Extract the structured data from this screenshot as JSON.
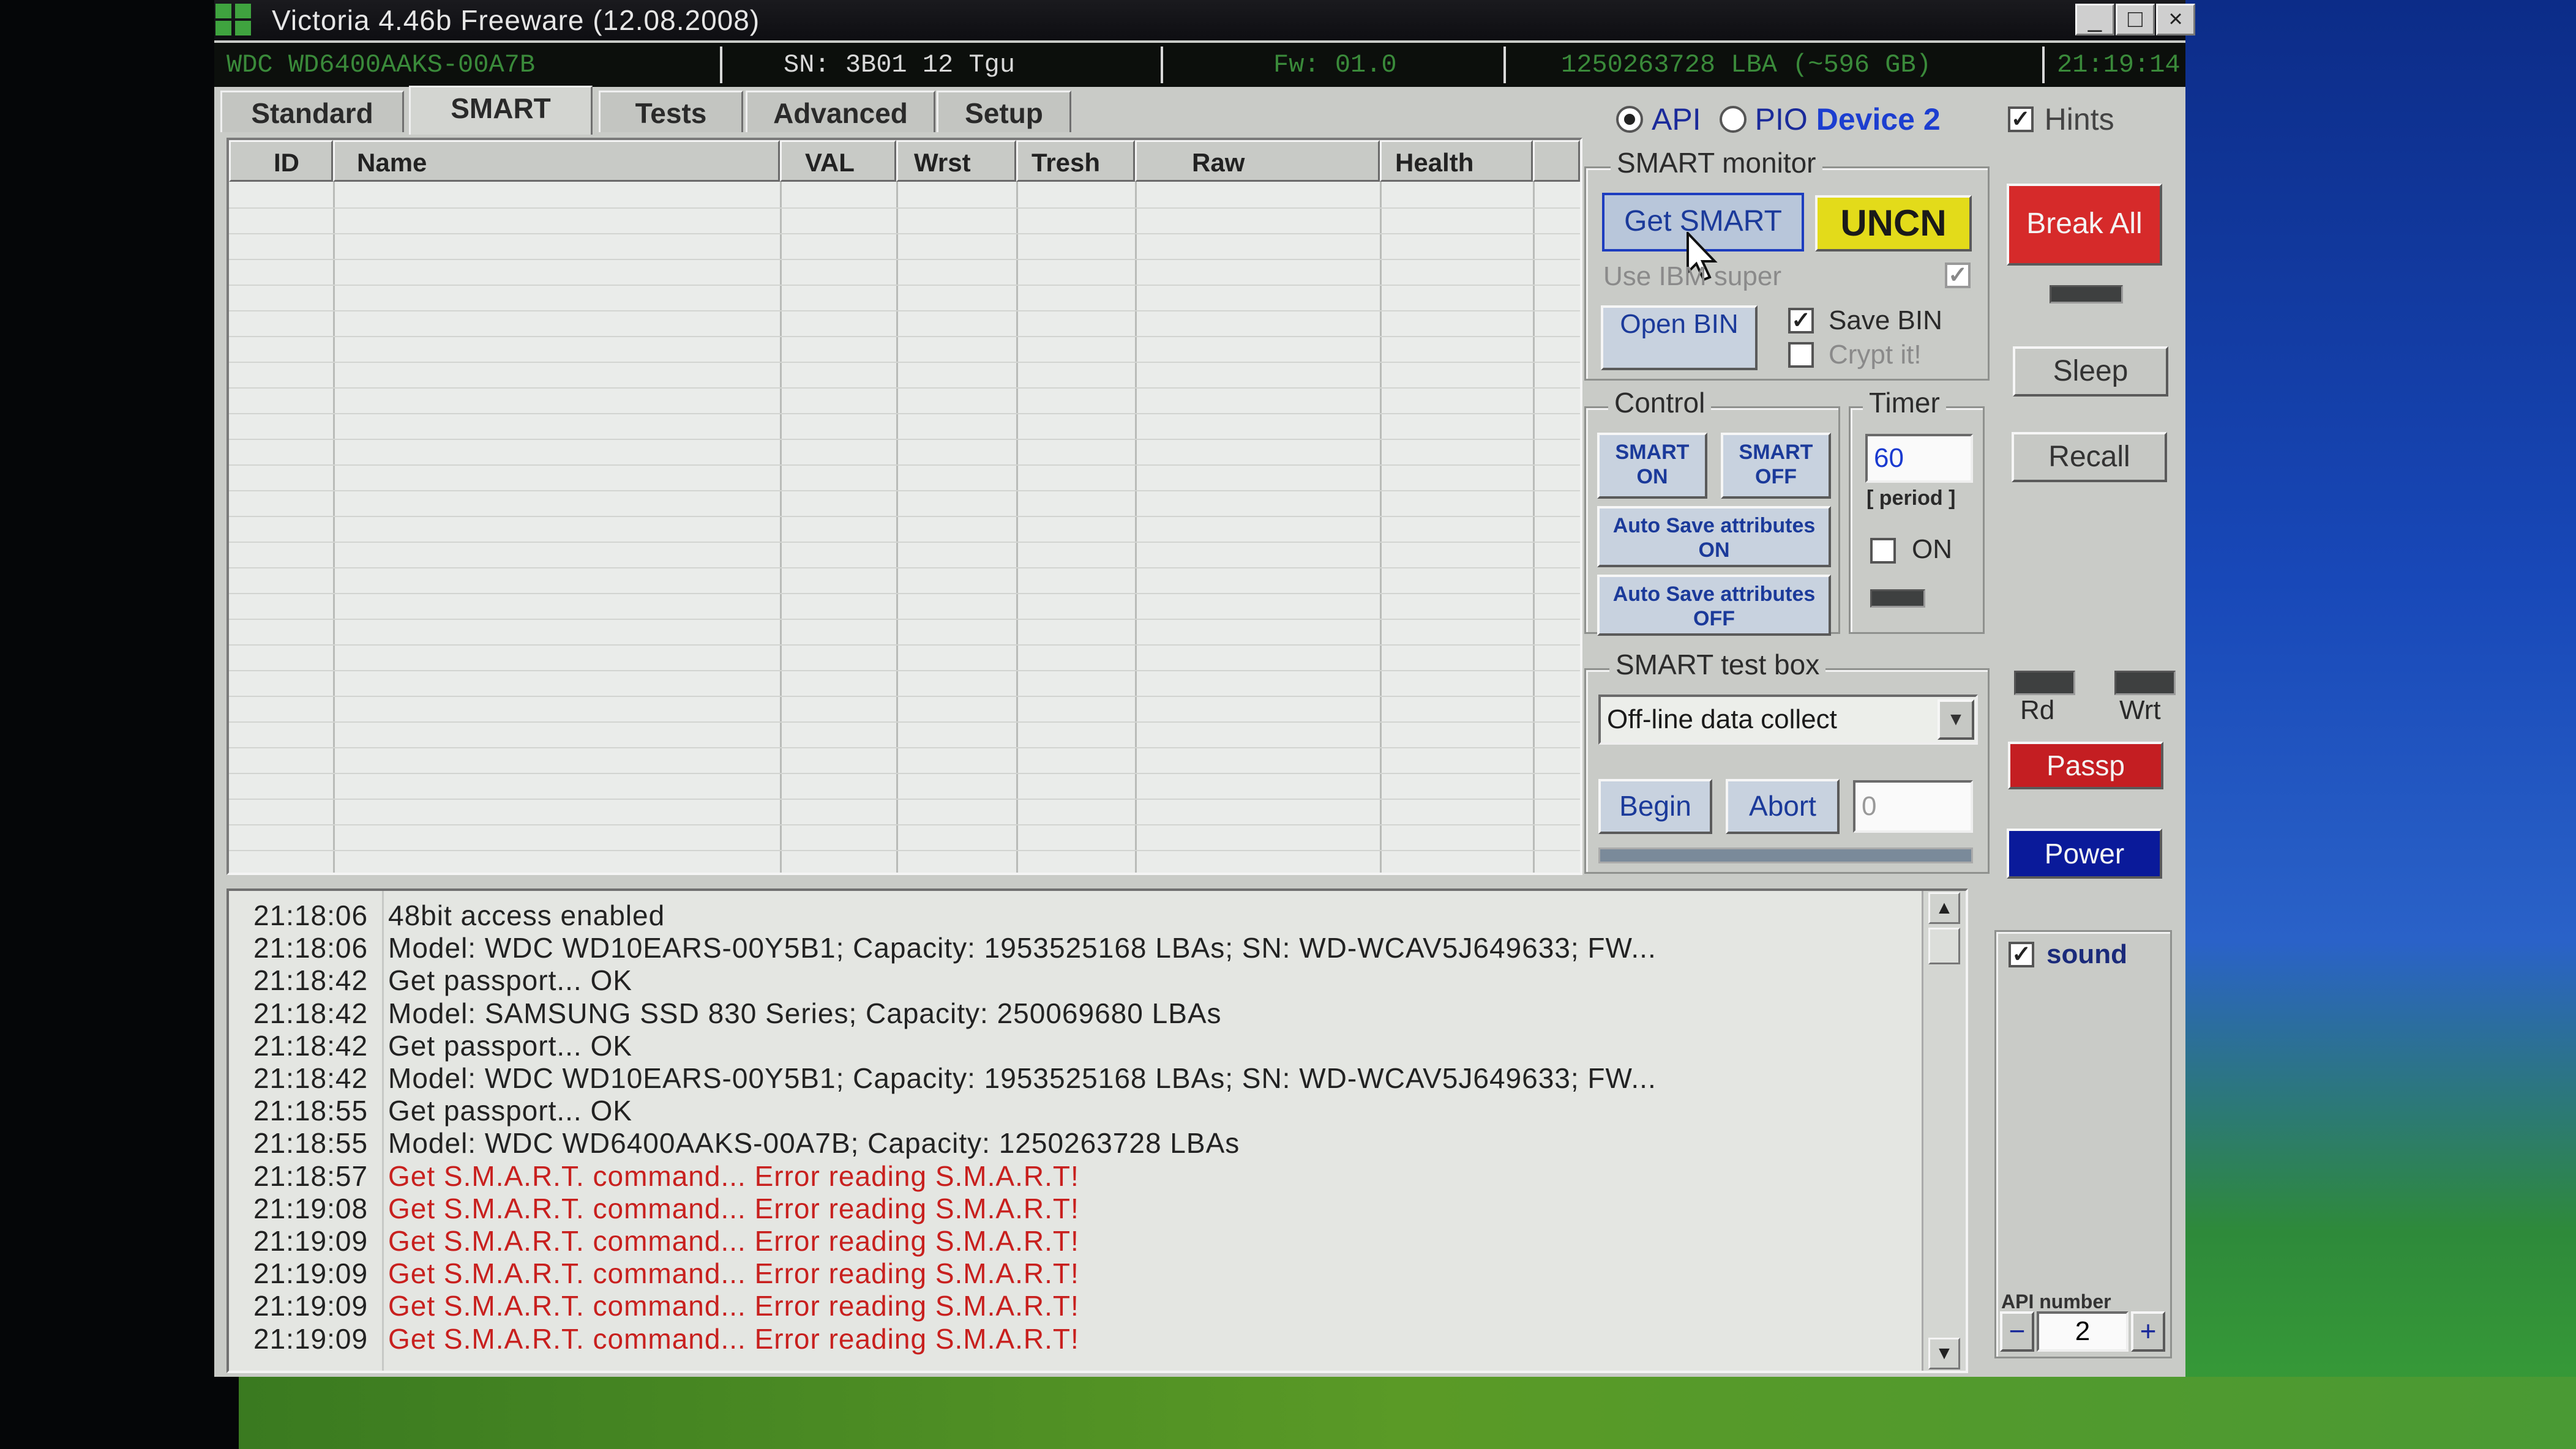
{
  "window": {
    "title": "Victoria 4.46b Freeware (12.08.2008)",
    "controls": [
      "_",
      "□",
      "×"
    ]
  },
  "infobar": {
    "model": "WDC    WD6400AAKS-00A7B",
    "serial": "SN: 3B01   12    Tgu",
    "firmware": "Fw: 01.0",
    "capacity": "1250263728 LBA (~596 GB)",
    "clock": "21:19:14"
  },
  "tabs": [
    "Standard",
    "SMART",
    "Tests",
    "Advanced",
    "Setup"
  ],
  "mode": {
    "api_label": "API",
    "pio_label": "PIO",
    "device_label": "Device 2",
    "hints_label": "Hints"
  },
  "smart_table": {
    "columns": [
      "ID",
      "Name",
      "VAL",
      "Wrst",
      "Tresh",
      "Raw",
      "Health"
    ]
  },
  "smart_monitor": {
    "title": "SMART monitor",
    "get_smart": "Get SMART",
    "status": "UNCN",
    "use_ibm": "Use IBM super",
    "open_bin": "Open BIN",
    "save_bin": "Save BIN",
    "crypt": "Crypt it!"
  },
  "control": {
    "title": "Control",
    "smart_on": "SMART ON",
    "smart_off": "SMART OFF",
    "autosave_on": "Auto Save attributes ON",
    "autosave_off": "Auto Save attributes OFF"
  },
  "timer": {
    "title": "Timer",
    "value": "60",
    "period": "[ period ]",
    "on_label": "ON"
  },
  "test_box": {
    "title": "SMART test box",
    "selected": "Off-line data collect",
    "begin": "Begin",
    "abort": "Abort",
    "progress": "0"
  },
  "right_panel": {
    "break_all": "Break All",
    "sleep": "Sleep",
    "recall": "Recall",
    "rd": "Rd",
    "wrt": "Wrt",
    "passp": "Passp",
    "power": "Power",
    "sound": "sound",
    "api_number_label": "API number",
    "api_number": "2",
    "minus": "−",
    "plus": "+"
  },
  "log": [
    {
      "time": "21:18:06",
      "msg": "48bit access enabled",
      "error": false
    },
    {
      "time": "21:18:06",
      "msg": "Model: WDC WD10EARS-00Y5B1; Capacity: 1953525168 LBAs; SN: WD-WCAV5J649633; FW...",
      "error": false
    },
    {
      "time": "21:18:42",
      "msg": "Get passport... OK",
      "error": false
    },
    {
      "time": "21:18:42",
      "msg": "Model: SAMSUNG SSD 830 Series; Capacity: 250069680 LBAs",
      "error": false
    },
    {
      "time": "21:18:42",
      "msg": "Get passport... OK",
      "error": false
    },
    {
      "time": "21:18:42",
      "msg": "Model: WDC WD10EARS-00Y5B1; Capacity: 1953525168 LBAs; SN: WD-WCAV5J649633; FW...",
      "error": false
    },
    {
      "time": "21:18:55",
      "msg": "Get passport... OK",
      "error": false
    },
    {
      "time": "21:18:55",
      "msg": "Model: WDC      WD6400AAKS-00A7B; Capacity: 1250263728 LBAs",
      "error": false
    },
    {
      "time": "21:18:57",
      "msg": "Get S.M.A.R.T. command... Error reading S.M.A.R.T!",
      "error": true
    },
    {
      "time": "21:19:08",
      "msg": "Get S.M.A.R.T. command... Error reading S.M.A.R.T!",
      "error": true
    },
    {
      "time": "21:19:09",
      "msg": "Get S.M.A.R.T. command... Error reading S.M.A.R.T!",
      "error": true
    },
    {
      "time": "21:19:09",
      "msg": "Get S.M.A.R.T. command... Error reading S.M.A.R.T!",
      "error": true
    },
    {
      "time": "21:19:09",
      "msg": "Get S.M.A.R.T. command... Error reading S.M.A.R.T!",
      "error": true
    },
    {
      "time": "21:19:09",
      "msg": "Get S.M.A.R.T. command... Error reading S.M.A.R.T!",
      "error": true
    }
  ],
  "colors": {
    "error": "#c8201e",
    "normal": "#222222",
    "uncn_bg": "#e3db1a",
    "break_bg": "#d62a2a",
    "power_bg": "#0a1a9a",
    "info_green": "#3a8a3a"
  }
}
